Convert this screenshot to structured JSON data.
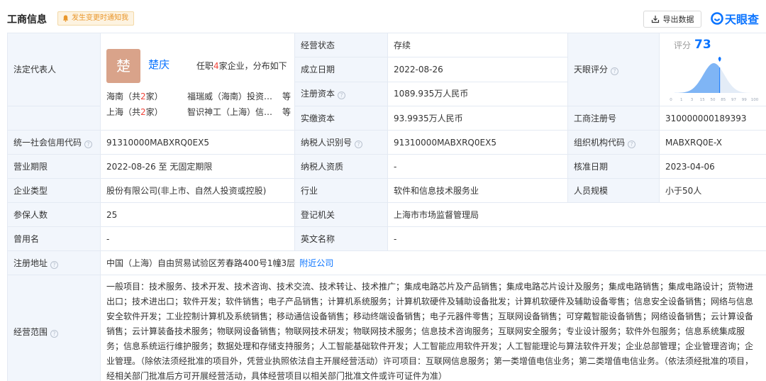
{
  "header": {
    "title": "工商信息",
    "notify_label": "发生变更时通知我",
    "export_label": "导出数据",
    "logo_text": "天眼查",
    "accent_color": "#0b74ff"
  },
  "legal_rep": {
    "label": "法定代表人",
    "avatar_char": "楚",
    "name": "楚庆",
    "info_pre": "任职",
    "info_count": "4",
    "info_post": "家企业，分布如下",
    "regions": [
      {
        "region_pre": "海南（共",
        "count": "2",
        "region_post": "家）",
        "company": "福瑞威（海南）投资…",
        "suffix": "等"
      },
      {
        "region_pre": "上海（共",
        "count": "2",
        "region_post": "家）",
        "company": "智识神工（上海）信…",
        "suffix": "等"
      }
    ]
  },
  "fields": {
    "status": {
      "label": "经营状态",
      "value": "存续"
    },
    "established": {
      "label": "成立日期",
      "value": "2022-08-26"
    },
    "reg_capital": {
      "label": "注册资本",
      "value": "1089.935万人民币"
    },
    "paid_capital": {
      "label": "实缴资本",
      "value": "93.9935万人民币"
    },
    "tyc_score": {
      "label": "天眼评分"
    },
    "reg_no": {
      "label": "工商注册号",
      "value": "310000000189393"
    },
    "credit_code": {
      "label": "统一社会信用代码",
      "value": "91310000MABXRQ0EX5"
    },
    "taxpayer_id": {
      "label": "纳税人识别号",
      "value": "91310000MABXRQ0EX5"
    },
    "org_code": {
      "label": "组织机构代码",
      "value": "MABXRQ0E-X"
    },
    "term": {
      "label": "营业期限",
      "value": "2022-08-26 至 无固定期限"
    },
    "taxpayer_qual": {
      "label": "纳税人资质",
      "value": "-"
    },
    "approval_date": {
      "label": "核准日期",
      "value": "2023-04-06"
    },
    "company_type": {
      "label": "企业类型",
      "value": "股份有限公司(非上市、自然人投资或控股)"
    },
    "industry": {
      "label": "行业",
      "value": "软件和信息技术服务业"
    },
    "staff_size": {
      "label": "人员规模",
      "value": "小于50人"
    },
    "insured": {
      "label": "参保人数",
      "value": "25"
    },
    "authority": {
      "label": "登记机关",
      "value": "上海市市场监督管理局"
    },
    "former_name": {
      "label": "曾用名",
      "value": "-"
    },
    "english_name": {
      "label": "英文名称",
      "value": "-"
    },
    "address": {
      "label": "注册地址",
      "value": "中国（上海）自由贸易试验区芳春路400号1幢3层",
      "link": "附近公司"
    },
    "scope": {
      "label": "经营范围",
      "value": "一般项目：技术服务、技术开发、技术咨询、技术交流、技术转让、技术推广；集成电路芯片及产品销售；集成电路芯片设计及服务；集成电路销售；集成电路设计；货物进出口；技术进出口；软件开发；软件销售；电子产品销售；计算机系统服务；计算机软硬件及辅助设备批发；计算机软硬件及辅助设备零售；信息安全设备销售；网络与信息安全软件开发；工业控制计算机及系统销售；移动通信设备销售；移动终端设备销售；电子元器件零售；互联网设备销售；可穿戴智能设备销售；网络设备销售；云计算设备销售；云计算装备技术服务；物联网设备销售；物联网技术研发；物联网技术服务；信息技术咨询服务；互联网安全服务；专业设计服务；软件外包服务；信息系统集成服务；信息系统运行维护服务；数据处理和存储支持服务；人工智能基础软件开发；人工智能应用软件开发；人工智能理论与算法软件开发；企业总部管理；企业管理咨询；企业管理。（除依法须经批准的项目外，凭营业执照依法自主开展经营活动）许可项目：互联网信息服务；第一类增值电信业务；第二类增值电信业务。（依法须经批准的项目，经相关部门批准后方可开展经营活动，具体经营项目以相关部门批准文件或许可证件为准）"
    }
  },
  "score": {
    "label": "评分",
    "value": "73",
    "score_numeric": 73,
    "axis_ticks": [
      "0",
      "1",
      "3",
      "15",
      "50",
      "85",
      "97",
      "99",
      "100"
    ]
  },
  "icons": {
    "bell": "bell-icon",
    "export": "export-icon",
    "logo": "tianyancha-logo-icon",
    "help": "question-circle-icon",
    "marker": "location-pin-icon"
  }
}
